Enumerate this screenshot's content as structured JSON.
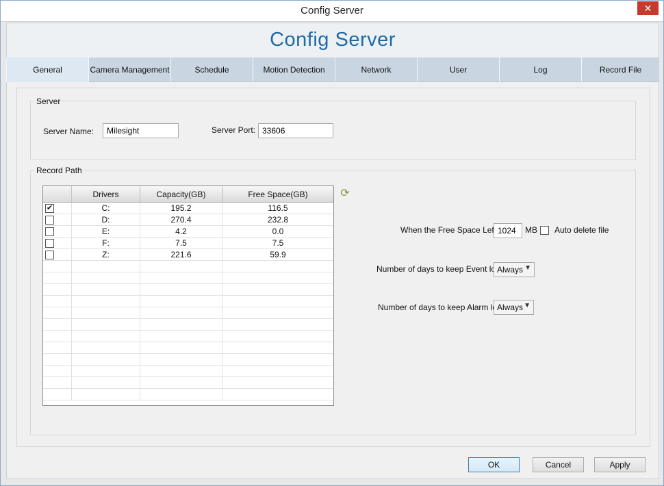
{
  "window": {
    "title": "Config Server",
    "close_glyph": "✕"
  },
  "banner": {
    "title": "Config Server"
  },
  "tabs": [
    {
      "label": "General"
    },
    {
      "label": "Camera Management"
    },
    {
      "label": "Schedule"
    },
    {
      "label": "Motion Detection"
    },
    {
      "label": "Network"
    },
    {
      "label": "User"
    },
    {
      "label": "Log"
    },
    {
      "label": "Record File"
    }
  ],
  "active_tab": "General",
  "server": {
    "group_label": "Server",
    "name_label": "Server Name:",
    "name_value": "Milesight",
    "port_label": "Server Port:",
    "port_value": "33606"
  },
  "record_path": {
    "group_label": "Record Path",
    "columns": [
      "Drivers",
      "Capacity(GB)",
      "Free Space(GB)"
    ],
    "rows": [
      {
        "checked": true,
        "driver": "C:",
        "capacity": "195.2",
        "free": "116.5"
      },
      {
        "checked": false,
        "driver": "D:",
        "capacity": "270.4",
        "free": "232.8"
      },
      {
        "checked": false,
        "driver": "E:",
        "capacity": "4.2",
        "free": "0.0"
      },
      {
        "checked": false,
        "driver": "F:",
        "capacity": "7.5",
        "free": "7.5"
      },
      {
        "checked": false,
        "driver": "Z:",
        "capacity": "221.6",
        "free": "59.9"
      }
    ],
    "refresh_icon": "refresh-icon"
  },
  "options": {
    "free_space_label": "When the Free Space Left:",
    "free_space_value": "1024",
    "free_space_unit": "MB",
    "auto_delete_label": "Auto delete file",
    "auto_delete_checked": false,
    "event_log_label": "Number of days to keep Event log:",
    "event_log_value": "Always",
    "alarm_log_label": "Number of days to keep Alarm log:",
    "alarm_log_value": "Always"
  },
  "buttons": {
    "ok": "OK",
    "cancel": "Cancel",
    "apply": "Apply"
  },
  "colors": {
    "accent": "#1f6aa5",
    "tab": "#c9d6e2",
    "tab_active": "#dde8f3",
    "close": "#c7392d"
  }
}
